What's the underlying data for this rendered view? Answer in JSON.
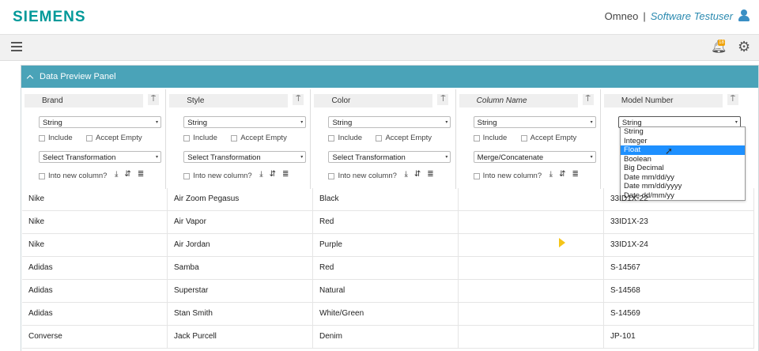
{
  "header": {
    "logo": "SIEMENS",
    "app_name": "Omneo",
    "separator": "|",
    "user_name": "Software Testuser",
    "notification_count": "18"
  },
  "panel": {
    "title": "Data Preview Panel"
  },
  "common": {
    "include_label": "Include",
    "accept_empty_label": "Accept Empty",
    "into_new_column_label": "Into new column?"
  },
  "columns": [
    {
      "name": "Brand",
      "type": "String",
      "transformation": "Select Transformation"
    },
    {
      "name": "Style",
      "type": "String",
      "transformation": "Select Transformation"
    },
    {
      "name": "Color",
      "type": "String",
      "transformation": "Select Transformation"
    },
    {
      "name": "Column Name",
      "type": "String",
      "transformation": "Merge/Concatenate"
    },
    {
      "name": "Model Number",
      "type": "String"
    }
  ],
  "type_dropdown": {
    "options": [
      "String",
      "Integer",
      "Float",
      "Boolean",
      "Big Decimal",
      "Date mm/dd/yy",
      "Date mm/dd/yyyy",
      "Date dd/mm/yy"
    ],
    "highlighted": "Float"
  },
  "rows": [
    [
      "Nike",
      "Air Zoom Pegasus",
      "Black",
      "",
      "33ID1X-22"
    ],
    [
      "Nike",
      "Air Vapor",
      "Red",
      "",
      "33ID1X-23"
    ],
    [
      "Nike",
      "Air Jordan",
      "Purple",
      "",
      "33ID1X-24"
    ],
    [
      "Adidas",
      "Samba",
      "Red",
      "",
      "S-14567"
    ],
    [
      "Adidas",
      "Superstar",
      "Natural",
      "",
      "S-14568"
    ],
    [
      "Adidas",
      "Stan Smith",
      "White/Green",
      "",
      "S-14569"
    ],
    [
      "Converse",
      "Jack Purcell",
      "Denim",
      "",
      "JP-101"
    ]
  ]
}
